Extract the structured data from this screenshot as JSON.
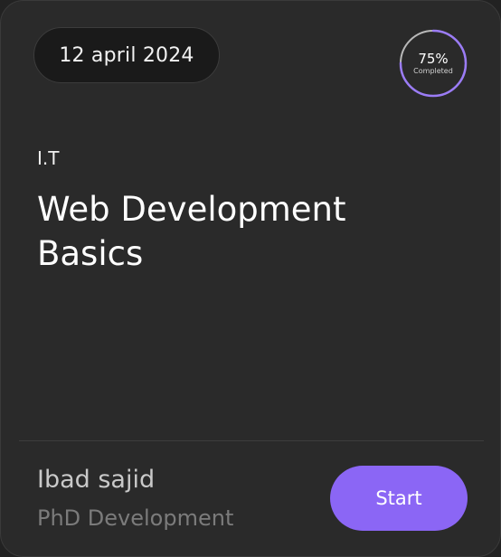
{
  "card": {
    "date": "12 april 2024",
    "progress": {
      "percent_label": "75%",
      "status_label": "Completed",
      "value": 0.75,
      "ring_color": "#9b7cf6",
      "track_color": "#b9b9b9"
    },
    "category": "I.T",
    "title": "Web Development Basics",
    "author": {
      "name": "Ibad sajid",
      "role": "PhD Development"
    },
    "start_button": {
      "label": "Start",
      "color": "#8b66f5"
    }
  }
}
